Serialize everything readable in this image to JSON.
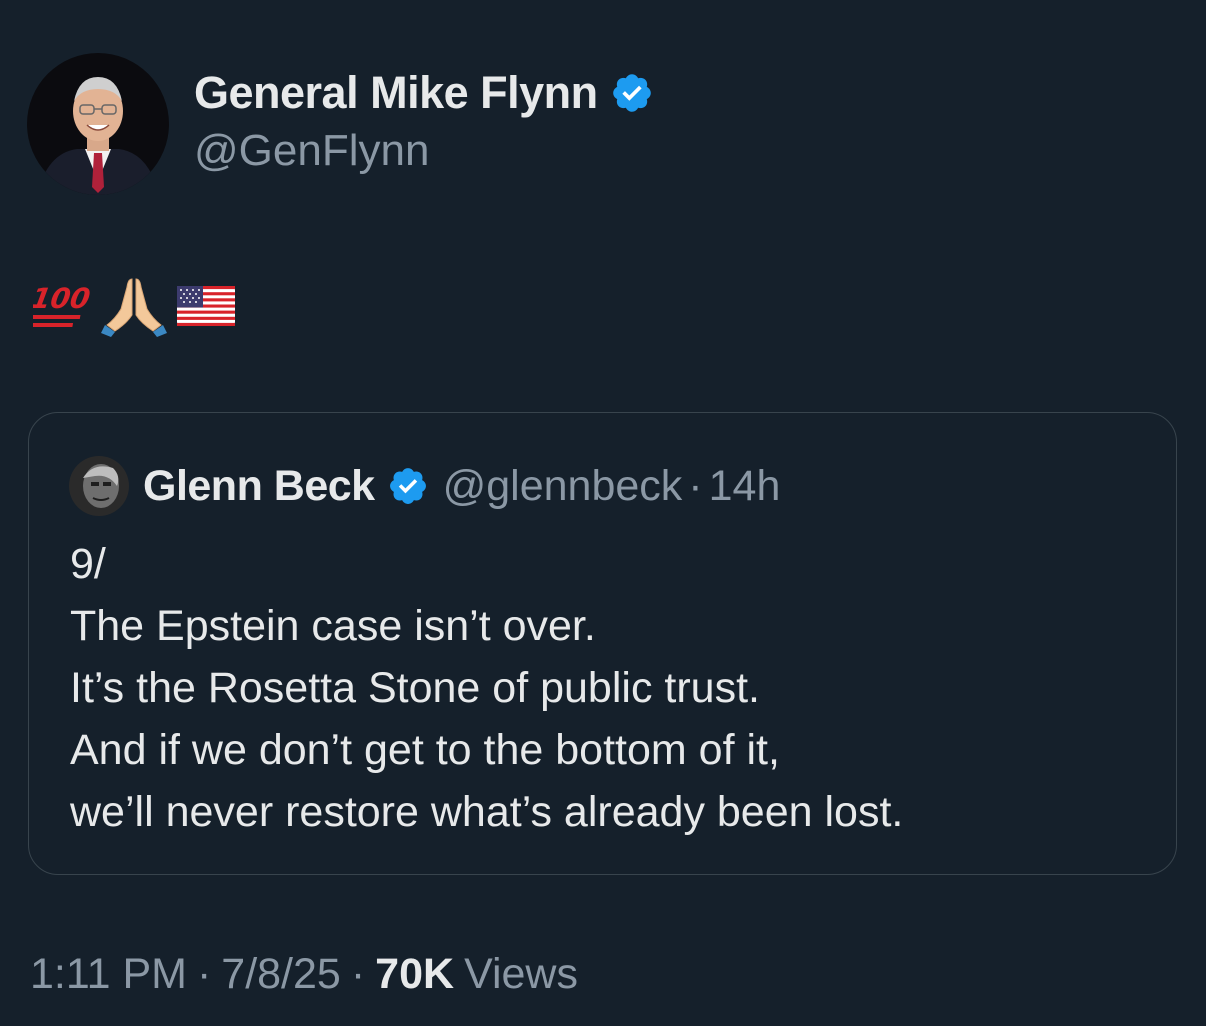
{
  "tweet": {
    "author": {
      "display_name": "General Mike Flynn",
      "handle": "@GenFlynn",
      "verified": true
    },
    "emojis": [
      "hundred-points-emoji",
      "folded-hands-emoji",
      "us-flag-emoji"
    ],
    "quoted": {
      "display_name": "Glenn Beck",
      "handle": "@glennbeck",
      "separator": "·",
      "time": "14h",
      "verified": true,
      "lines": [
        "9/",
        "The Epstein case isn’t over.",
        "It’s the Rosetta Stone of public trust.",
        "And if we don’t get to the bottom of it,",
        "we’ll never restore what’s already been lost."
      ]
    },
    "meta": {
      "time": "1:11 PM",
      "date": "7/8/25",
      "separator": "·",
      "views_count": "70K",
      "views_label": "Views"
    }
  },
  "colors": {
    "background": "#15202b",
    "text_primary": "#e7e9ea",
    "text_secondary": "#8b98a5",
    "verified_blue": "#1d9bf0",
    "border": "#38444d"
  }
}
